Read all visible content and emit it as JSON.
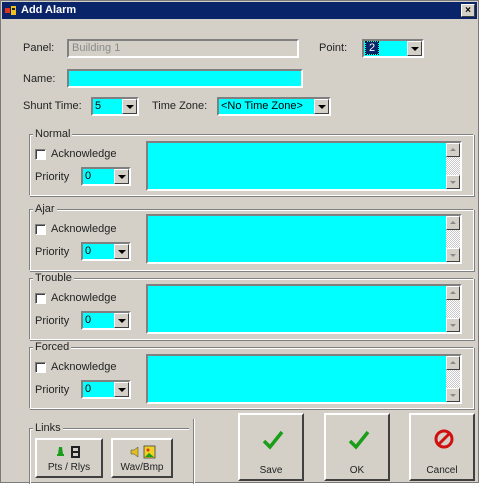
{
  "window": {
    "title": "Add Alarm",
    "close_glyph": "×"
  },
  "panel": {
    "label": "Panel:",
    "value": "Building 1"
  },
  "point": {
    "label": "Point:",
    "value": "2"
  },
  "name": {
    "label": "Name:",
    "value": ""
  },
  "shunt_time": {
    "label": "Shunt Time:",
    "value": "5"
  },
  "time_zone": {
    "label": "Time Zone:",
    "value": "<No Time Zone>"
  },
  "sections": [
    {
      "title": "Normal",
      "ack_label": "Acknowledge",
      "priority_label": "Priority",
      "priority_value": "0"
    },
    {
      "title": "Ajar",
      "ack_label": "Acknowledge",
      "priority_label": "Priority",
      "priority_value": "0"
    },
    {
      "title": "Trouble",
      "ack_label": "Acknowledge",
      "priority_label": "Priority",
      "priority_value": "0"
    },
    {
      "title": "Forced",
      "ack_label": "Acknowledge",
      "priority_label": "Priority",
      "priority_value": "0"
    }
  ],
  "links": {
    "title": "Links",
    "pts_button": "Pts / Rlys",
    "wav_button": "Wav/Bmp"
  },
  "buttons": {
    "save": "Save",
    "ok": "OK",
    "cancel": "Cancel"
  },
  "colors": {
    "field": "#00ffff",
    "titlebar": "#0a246a",
    "dialog": "#d4d0c8",
    "check_green": "#1a9e1a",
    "cancel_red": "#d01010"
  }
}
